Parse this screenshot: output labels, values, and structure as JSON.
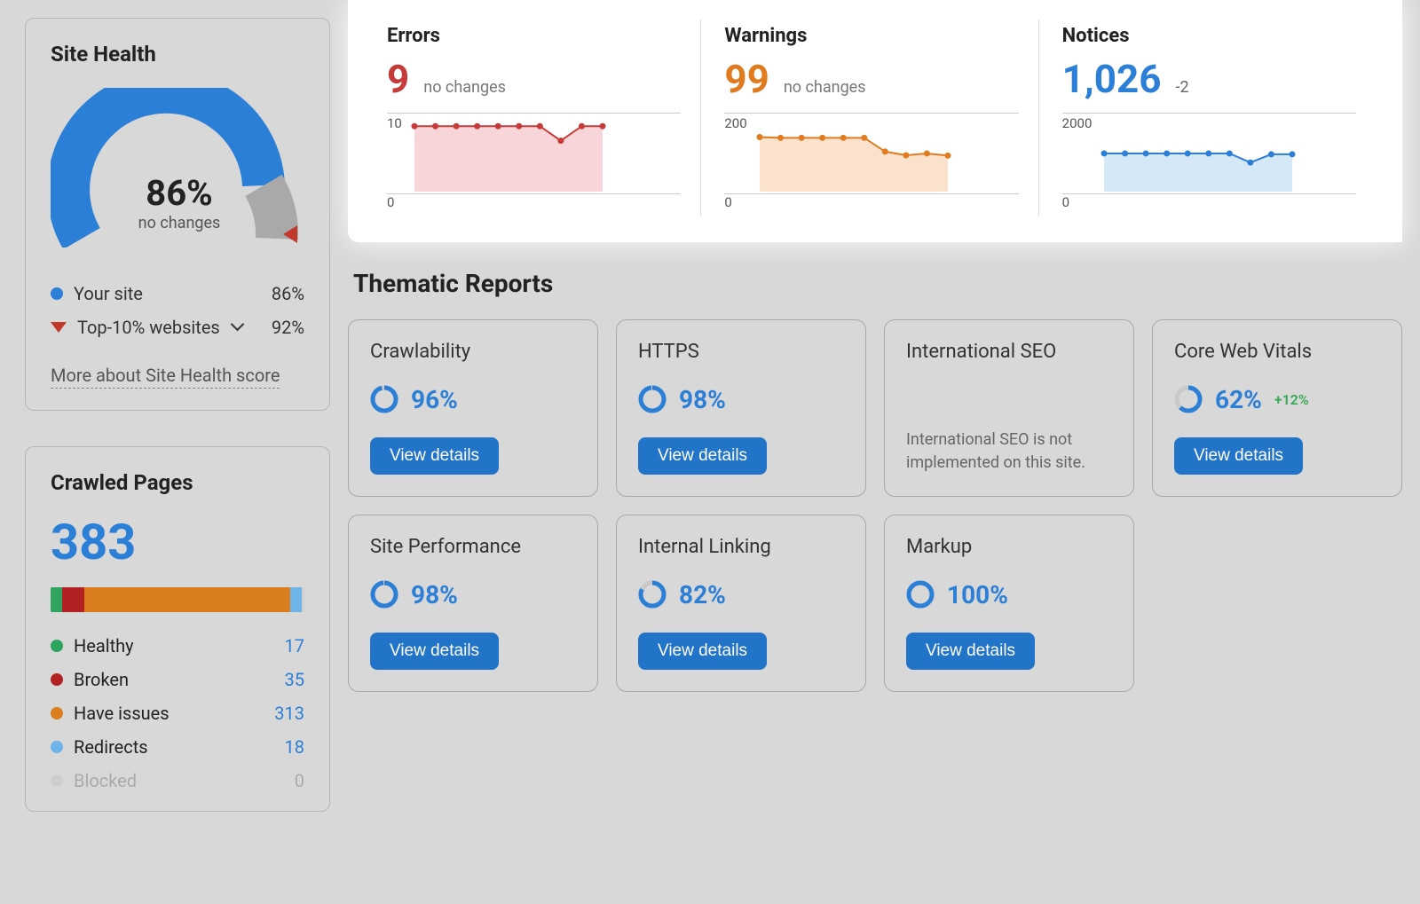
{
  "site_health": {
    "title": "Site Health",
    "score_label": "86%",
    "sub_label": "no changes",
    "legend_your_site": "Your site",
    "legend_your_site_pct": "86%",
    "legend_top": "Top-10% websites",
    "legend_top_pct": "92%",
    "more_link": "More about Site Health score"
  },
  "crawled": {
    "title": "Crawled Pages",
    "total": "383",
    "items": [
      {
        "label": "Healthy",
        "value": "17",
        "color": "#2fa360"
      },
      {
        "label": "Broken",
        "value": "35",
        "color": "#b22222"
      },
      {
        "label": "Have issues",
        "value": "313",
        "color": "#d97d1e"
      },
      {
        "label": "Redirects",
        "value": "18",
        "color": "#6fb4e8"
      },
      {
        "label": "Blocked",
        "value": "0",
        "color": "#cfcfcf"
      }
    ]
  },
  "issues": {
    "errors": {
      "title": "Errors",
      "value": "9",
      "sub": "no changes",
      "ytop": "10",
      "ybot": "0"
    },
    "warnings": {
      "title": "Warnings",
      "value": "99",
      "sub": "no changes",
      "ytop": "200",
      "ybot": "0"
    },
    "notices": {
      "title": "Notices",
      "value": "1,026",
      "delta": "-2",
      "ytop": "2000",
      "ybot": "0"
    }
  },
  "thematic": {
    "title": "Thematic Reports",
    "view_details": "View details",
    "cards": [
      {
        "title": "Crawlability",
        "score": "96%"
      },
      {
        "title": "HTTPS",
        "score": "98%"
      },
      {
        "title": "International SEO",
        "msg": "International SEO is not implemented on this site."
      },
      {
        "title": "Core Web Vitals",
        "score": "62%",
        "delta": "+12%"
      },
      {
        "title": "Site Performance",
        "score": "98%"
      },
      {
        "title": "Internal Linking",
        "score": "82%"
      },
      {
        "title": "Markup",
        "score": "100%"
      }
    ]
  },
  "chart_data": [
    {
      "type": "area",
      "name": "Errors",
      "ylim": [
        0,
        10
      ],
      "x": [
        1,
        2,
        3,
        4,
        5,
        6,
        7,
        8,
        9,
        10
      ],
      "values": [
        9,
        9,
        9,
        9,
        9,
        9,
        9,
        7,
        9,
        9
      ],
      "color": "#c63a3a"
    },
    {
      "type": "area",
      "name": "Warnings",
      "ylim": [
        0,
        200
      ],
      "x": [
        1,
        2,
        3,
        4,
        5,
        6,
        7,
        8,
        9,
        10
      ],
      "values": [
        150,
        148,
        148,
        148,
        148,
        148,
        110,
        100,
        105,
        99
      ],
      "color": "#e07b1f"
    },
    {
      "type": "area",
      "name": "Notices",
      "ylim": [
        0,
        2000
      ],
      "x": [
        1,
        2,
        3,
        4,
        5,
        6,
        7,
        8,
        9,
        10
      ],
      "values": [
        1050,
        1050,
        1050,
        1050,
        1050,
        1050,
        1050,
        800,
        1026,
        1026
      ],
      "color": "#2c7fd6"
    }
  ]
}
